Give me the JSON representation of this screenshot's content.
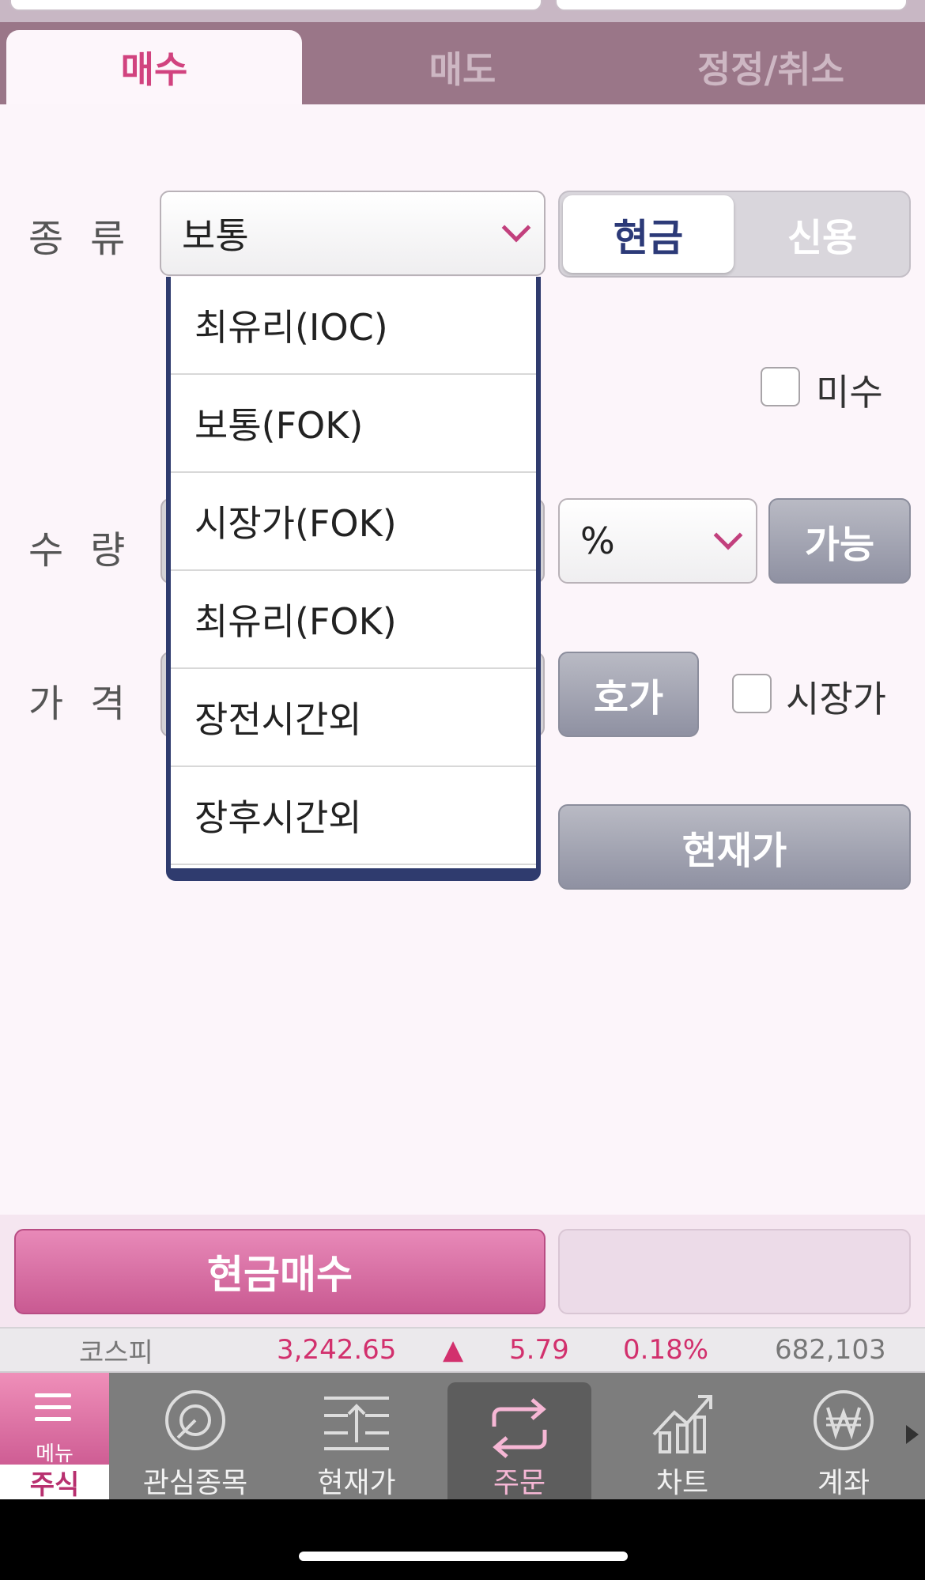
{
  "tabs": {
    "buy": "매수",
    "sell": "매도",
    "modify": "정정/취소"
  },
  "labels": {
    "type": "종류",
    "quantity": "수량",
    "price": "가격"
  },
  "type_select": {
    "value": "보통"
  },
  "payment_toggle": {
    "cash": "현금",
    "credit": "신용",
    "selected": "현금"
  },
  "misu": {
    "label": "미수",
    "checked": false
  },
  "unit_select": {
    "value": "%"
  },
  "buttons": {
    "possible": "가능",
    "hoga": "호가",
    "current_price": "현재가",
    "order": "현금매수"
  },
  "market_price": {
    "label": "시장가",
    "checked": false
  },
  "dropdown_options": [
    "최유리(IOC)",
    "보통(FOK)",
    "시장가(FOK)",
    "최유리(FOK)",
    "장전시간외",
    "장후시간외"
  ],
  "ticker": {
    "index": "코스피",
    "value": "3,242.65",
    "arrow": "▲",
    "change": "5.79",
    "percent": "0.18%",
    "volume": "682,103",
    "up_color": "#d2306d"
  },
  "nav": {
    "menu": "메뉴",
    "stock": "주식",
    "items": [
      {
        "label": "관심종목",
        "icon": "watchlist-icon"
      },
      {
        "label": "현재가",
        "icon": "current-price-icon"
      },
      {
        "label": "주문",
        "icon": "order-icon",
        "active": true
      },
      {
        "label": "차트",
        "icon": "chart-icon"
      },
      {
        "label": "계좌",
        "icon": "won-account-icon"
      }
    ]
  },
  "colors": {
    "accent": "#d1437f",
    "header": "#9a7688",
    "navy": "#2c3a78"
  }
}
